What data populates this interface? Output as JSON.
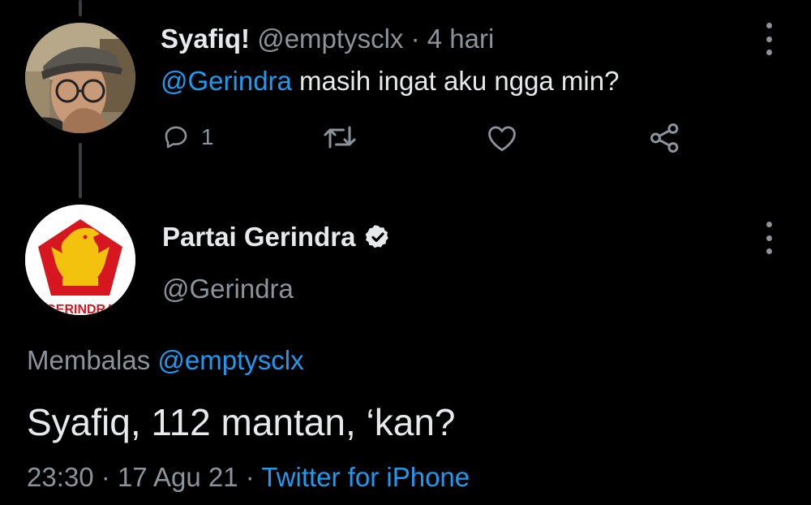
{
  "reply_tweet": {
    "display_name": "Syafiq!",
    "handle": "@emptysclx",
    "separator": "·",
    "time_ago": "4 hari",
    "mention": "@Gerindra",
    "text": " masih ingat aku ngga min?",
    "reply_count": "1",
    "icons": [
      "reply-icon",
      "retweet-icon",
      "like-icon",
      "share-icon",
      "more-icon"
    ]
  },
  "main_tweet": {
    "display_name": "Partai Gerindra",
    "handle": "@Gerindra",
    "verified": true,
    "replying_label": "Membalas ",
    "replying_to": "@emptysclx",
    "text": "Syafiq, 112 mantan, ‘kan?",
    "time": "23:30",
    "date": "17 Agu 21",
    "separator": "·",
    "source": "Twitter for iPhone",
    "logo_text": "GERINDRA"
  },
  "colors": {
    "background": "#000000",
    "text": "#e7e9ea",
    "muted": "#8b949a",
    "link": "#1d9bf0",
    "logo_red": "#d7171f",
    "logo_gold": "#f2c20f"
  }
}
